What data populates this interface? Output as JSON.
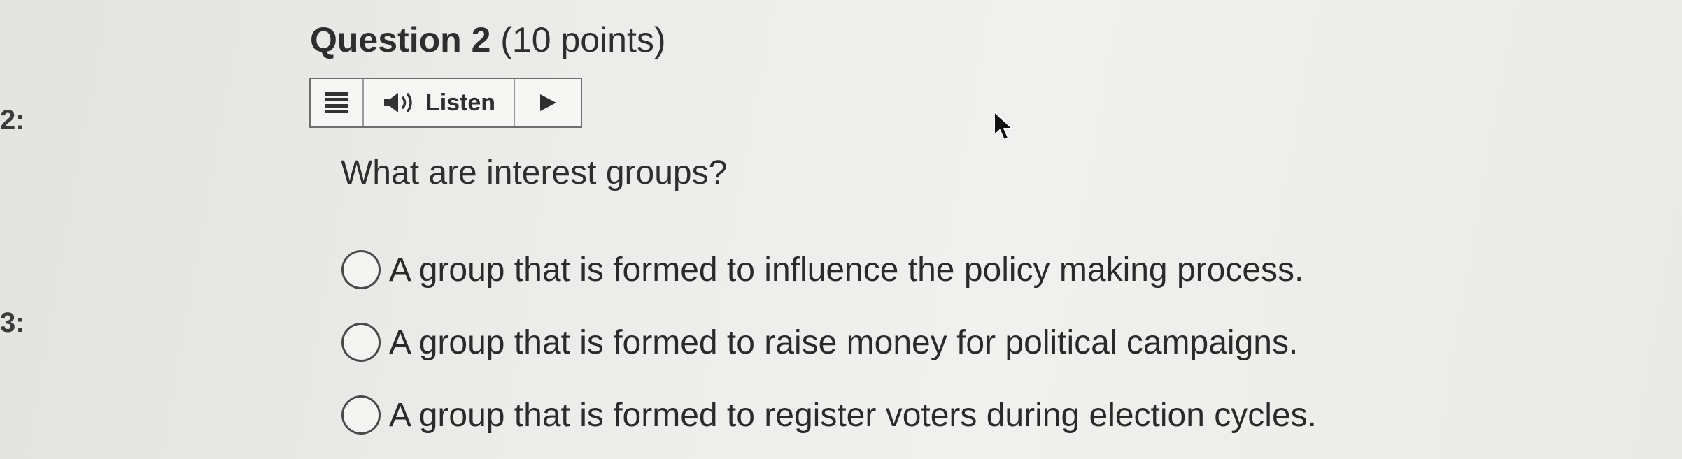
{
  "sidebar": {
    "prev_label": "2:",
    "next_label": "3:"
  },
  "question": {
    "title": "Question 2",
    "points": "(10 points)",
    "prompt": "What are interest groups?"
  },
  "toolbar": {
    "listen_label": "Listen"
  },
  "options": [
    {
      "label": "A group that is formed to influence the policy making process.",
      "selected": false
    },
    {
      "label": "A group that is formed to raise money for political campaigns.",
      "selected": false
    },
    {
      "label": "A group that is formed to register voters during election cycles.",
      "selected": false
    }
  ],
  "icons": {
    "menu": "menu-icon",
    "speaker": "speaker-icon",
    "play": "play-icon",
    "cursor": "mouse-cursor-icon"
  }
}
